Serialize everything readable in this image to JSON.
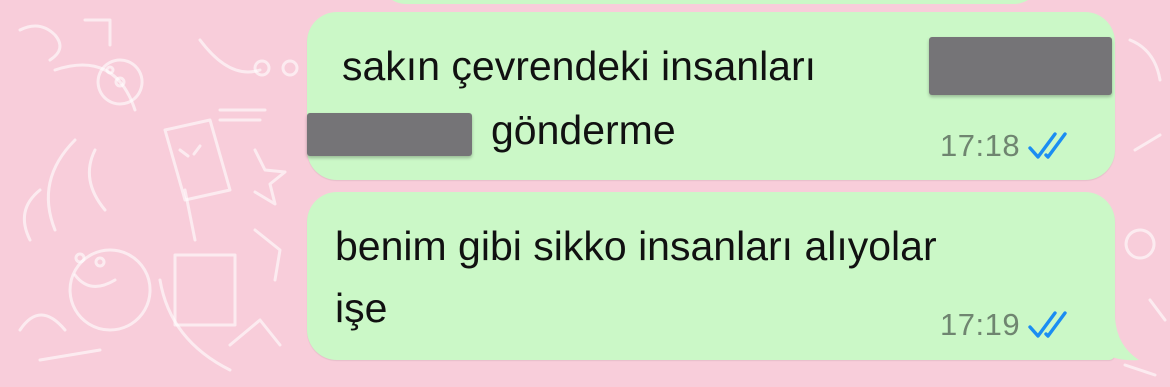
{
  "messages": [
    {
      "text_line1": "sakın çevrendeki insanları",
      "text_line2": "gönderme",
      "time": "17:18",
      "status_icon": "double-check-read-icon"
    },
    {
      "text_line1": "benim gibi sikko insanları alıyolar",
      "text_line2": "işe",
      "time": "17:19",
      "status_icon": "double-check-read-icon"
    }
  ],
  "colors": {
    "wallpaper": "#f8cdda",
    "outgoing_bubble": "#cbf8c7",
    "read_ticks": "#1b8df2",
    "timestamp": "#6f8570",
    "redaction": "#757477"
  }
}
